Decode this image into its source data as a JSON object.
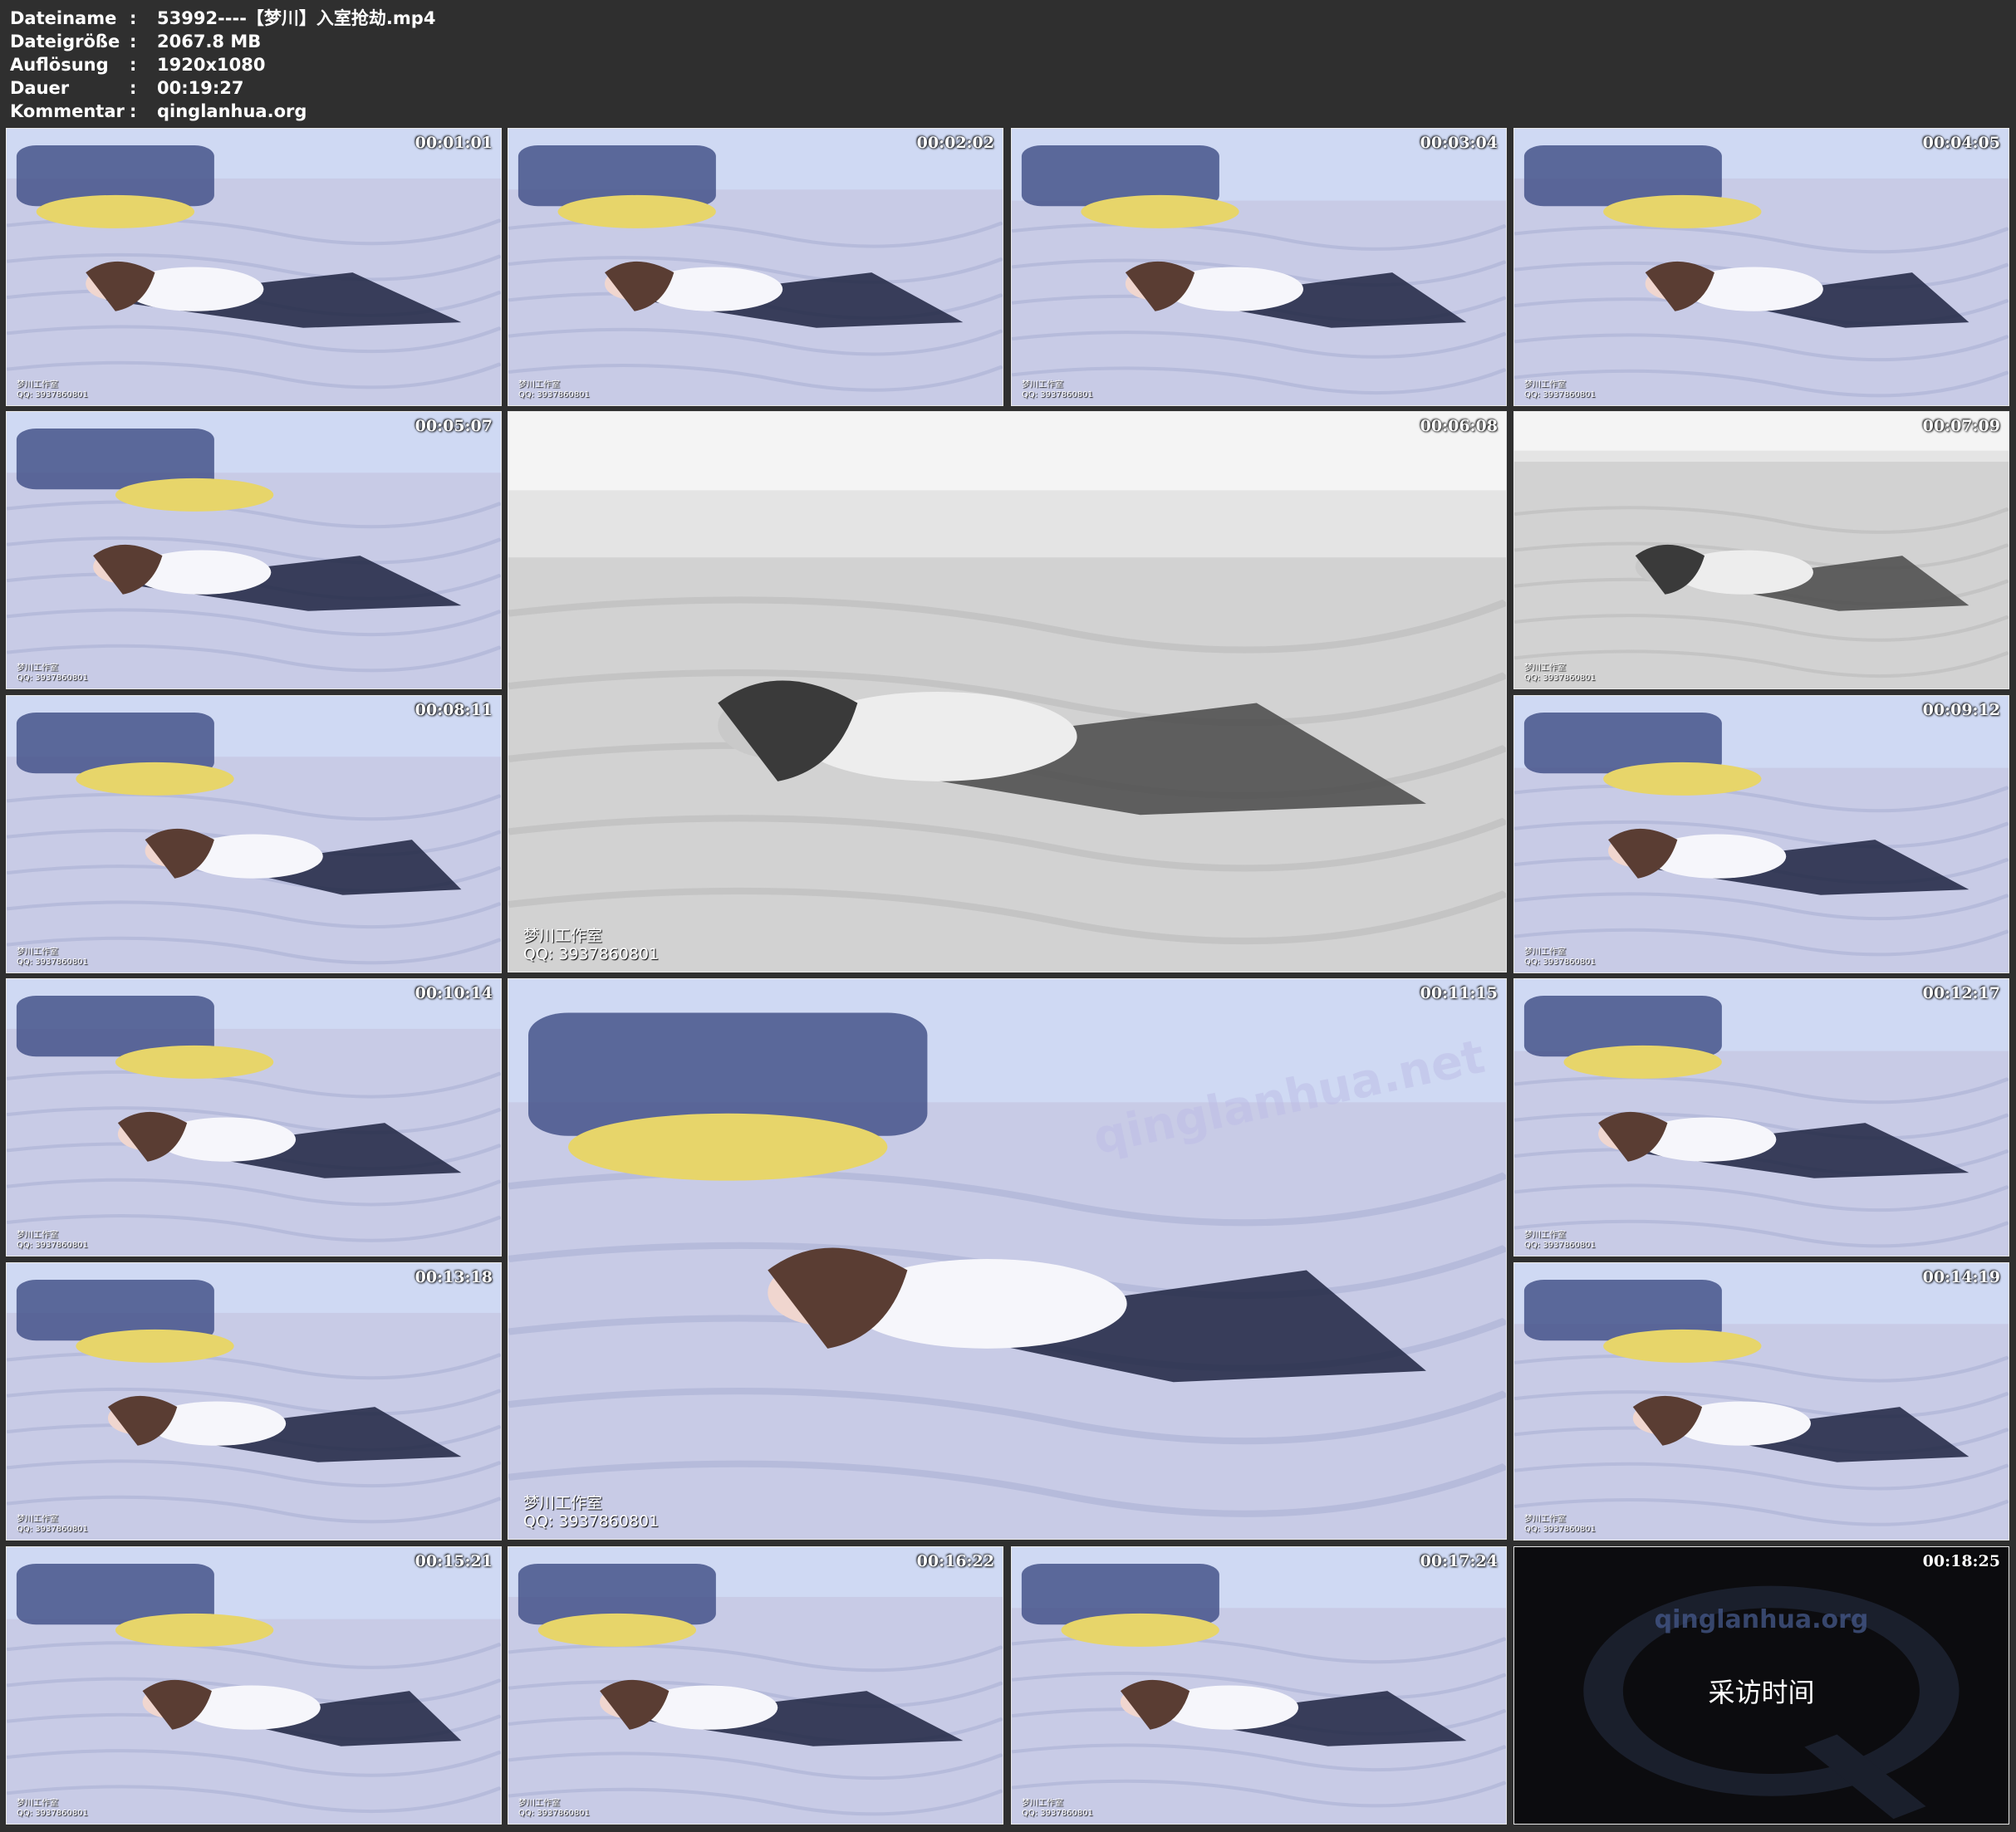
{
  "info": [
    {
      "key": "Dateiname",
      "value": "53992----【梦川】入室抢劫.mp4"
    },
    {
      "key": "Dateigröße",
      "value": "2067.8 MB"
    },
    {
      "key": "Auflösung",
      "value": "1920x1080"
    },
    {
      "key": "Dauer",
      "value": "00:19:27"
    },
    {
      "key": "Kommentar",
      "value": "qinglanhua.org"
    }
  ],
  "separator": ":",
  "watermark": {
    "studio": "梦川工作室",
    "qq": "QQ: 3937860801"
  },
  "site_watermark": "qinglanhua.net",
  "end_card": {
    "site": "qinglanhua.org",
    "title": "采访时间"
  },
  "thumbnails": [
    {
      "time": "00:01:01",
      "scene": "color"
    },
    {
      "time": "00:02:02",
      "scene": "color"
    },
    {
      "time": "00:03:04",
      "scene": "color"
    },
    {
      "time": "00:04:05",
      "scene": "color"
    },
    {
      "time": "00:05:07",
      "scene": "color"
    },
    {
      "time": "00:06:08",
      "scene": "grayscale"
    },
    {
      "time": "00:07:09",
      "scene": "grayscale"
    },
    {
      "time": "00:08:11",
      "scene": "color"
    },
    {
      "time": "00:09:12",
      "scene": "color"
    },
    {
      "time": "00:10:14",
      "scene": "color"
    },
    {
      "time": "00:11:15",
      "scene": "color"
    },
    {
      "time": "00:12:17",
      "scene": "color"
    },
    {
      "time": "00:13:18",
      "scene": "color"
    },
    {
      "time": "00:14:19",
      "scene": "color"
    },
    {
      "time": "00:15:21",
      "scene": "color"
    },
    {
      "time": "00:16:22",
      "scene": "color"
    },
    {
      "time": "00:17:24",
      "scene": "color"
    },
    {
      "time": "00:18:25",
      "scene": "end-card"
    }
  ]
}
